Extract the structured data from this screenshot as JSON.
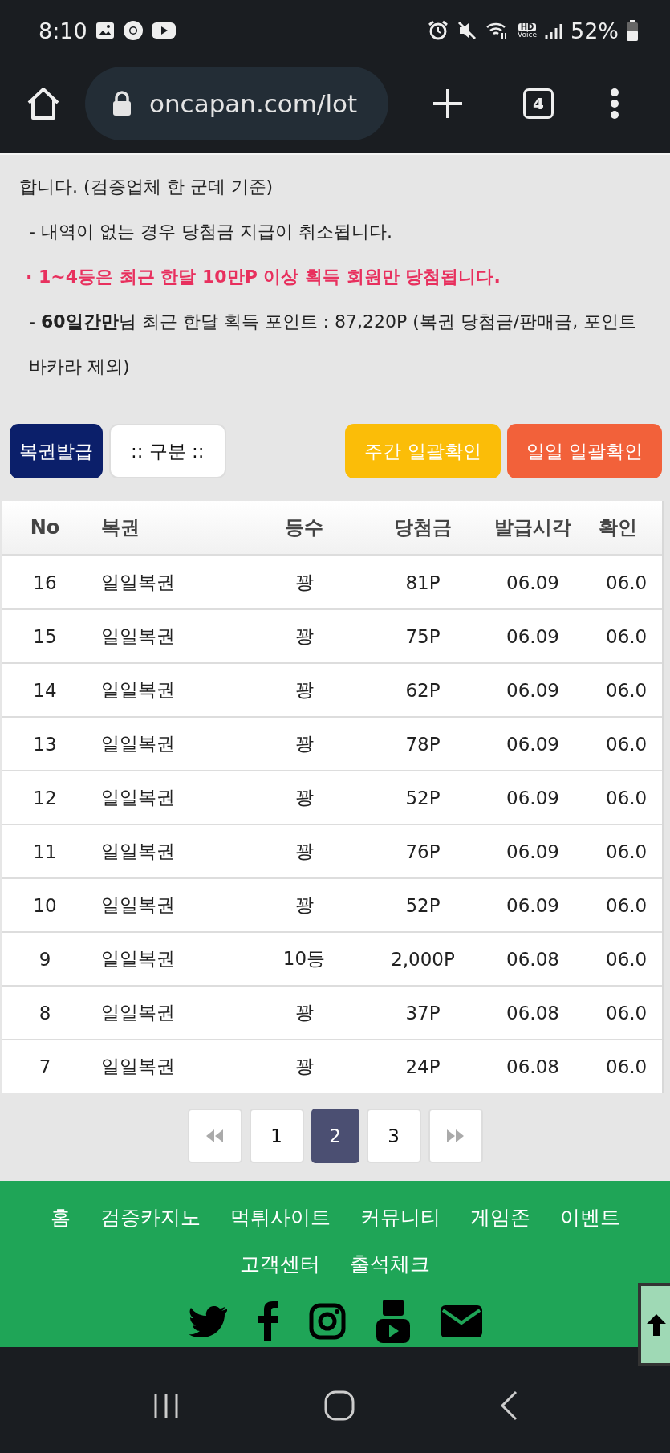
{
  "status_bar": {
    "time": "8:10",
    "hd_voice": [
      "HD",
      "Voice"
    ],
    "battery": "52%"
  },
  "browser": {
    "url": "oncapan.com/lot",
    "tab_count": "4"
  },
  "notice": [
    {
      "kind": "plain",
      "text": "합니다. (검증업체 한 군데 기준)"
    },
    {
      "kind": "item",
      "text": "- 내역이 없는 경우 당첨금 지급이 취소됩니다."
    },
    {
      "kind": "alert",
      "text": "· 1~4등은 최근 한달 10만P 이상 획득 회원만 당첨됩니다."
    },
    {
      "kind": "item",
      "text": "- **60일간만**님 최근 한달 획득 포인트 : 87,220P (복권 당첨금/판매금, 포인트 바카라 제외)"
    }
  ],
  "actions": [
    {
      "kind": "issue",
      "label": "복권발급",
      "color": "#0b1f6a"
    },
    {
      "kind": "filter",
      "label": ":: 구분 ::",
      "color": "#ffffff"
    },
    {
      "kind": "weekly",
      "label": "주간 일괄확인",
      "color": "#fbbd08"
    },
    {
      "kind": "daily",
      "label": "일일 일괄확인",
      "color": "#f2613a"
    }
  ],
  "table": {
    "columns": [
      "No",
      "복권",
      "등수",
      "당첨금",
      "발급시각",
      "확인"
    ],
    "rows": [
      [
        "16",
        "일일복권",
        "꽝",
        "81P",
        "06.09",
        "06.0"
      ],
      [
        "15",
        "일일복권",
        "꽝",
        "75P",
        "06.09",
        "06.0"
      ],
      [
        "14",
        "일일복권",
        "꽝",
        "62P",
        "06.09",
        "06.0"
      ],
      [
        "13",
        "일일복권",
        "꽝",
        "78P",
        "06.09",
        "06.0"
      ],
      [
        "12",
        "일일복권",
        "꽝",
        "52P",
        "06.09",
        "06.0"
      ],
      [
        "11",
        "일일복권",
        "꽝",
        "76P",
        "06.09",
        "06.0"
      ],
      [
        "10",
        "일일복권",
        "꽝",
        "52P",
        "06.09",
        "06.0"
      ],
      [
        "9",
        "일일복권",
        "10등",
        "2,000P",
        "06.08",
        "06.0"
      ],
      [
        "8",
        "일일복권",
        "꽝",
        "37P",
        "06.08",
        "06.0"
      ],
      [
        "7",
        "일일복권",
        "꽝",
        "24P",
        "06.08",
        "06.0"
      ]
    ]
  },
  "pagination": [
    {
      "kind": "first"
    },
    {
      "kind": "page",
      "label": "1",
      "selected": false
    },
    {
      "kind": "page",
      "label": "2",
      "selected": true
    },
    {
      "kind": "page",
      "label": "3",
      "selected": false
    },
    {
      "kind": "last"
    }
  ],
  "footer": {
    "links": [
      "홈",
      "검증카지노",
      "먹튀사이트",
      "커뮤니티",
      "게임존",
      "이벤트",
      "고객센터",
      "출석체크"
    ]
  }
}
